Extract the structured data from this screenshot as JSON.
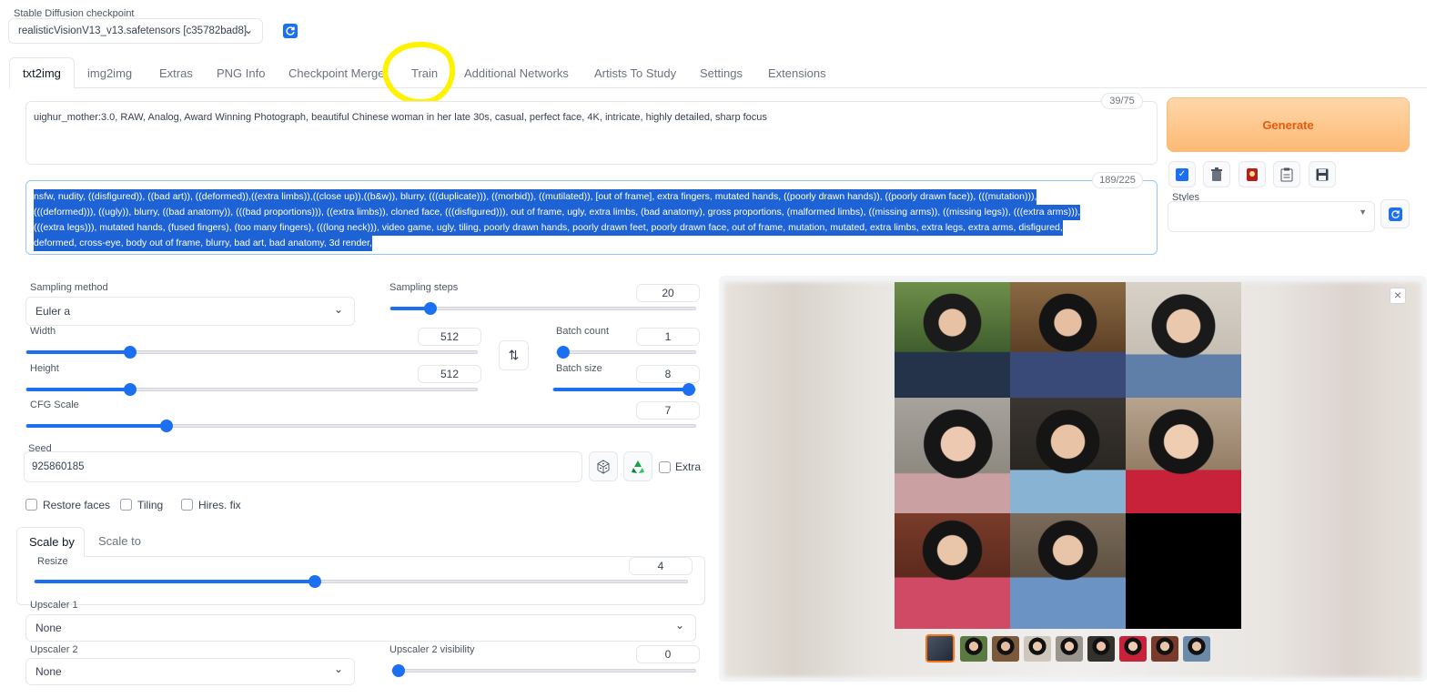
{
  "checkpoint": {
    "label": "Stable Diffusion checkpoint",
    "value": "realisticVisionV13_v13.safetensors [c35782bad8]"
  },
  "tabs": [
    {
      "label": "txt2img"
    },
    {
      "label": "img2img"
    },
    {
      "label": "Extras"
    },
    {
      "label": "PNG Info"
    },
    {
      "label": "Checkpoint Merger"
    },
    {
      "label": "Train"
    },
    {
      "label": "Additional Networks"
    },
    {
      "label": "Artists To Study"
    },
    {
      "label": "Settings"
    },
    {
      "label": "Extensions"
    }
  ],
  "prompt": {
    "text": "uighur_mother:3.0, RAW, Analog, Award Winning Photograph, beautiful Chinese woman in her late 30s, casual, perfect face, 4K, intricate, highly detailed, sharp focus",
    "counter": "39/75"
  },
  "negative_prompt": {
    "lines": [
      "nsfw, nudity, ((disfigured)), ((bad art)), ((deformed)),((extra limbs)),((close up)),((b&w)), blurry, (((duplicate))), ((morbid)), ((mutilated)), [out of frame], extra fingers, mutated hands, ((poorly drawn hands)), ((poorly drawn face)), (((mutation))),",
      "(((deformed))), ((ugly)), blurry, ((bad anatomy)), (((bad proportions))), ((extra limbs)), cloned face, (((disfigured))), out of frame, ugly, extra limbs, (bad anatomy), gross proportions, (malformed limbs), ((missing arms)), ((missing legs)), (((extra arms))),",
      "(((extra legs))), mutated hands, (fused fingers), (too many fingers), (((long neck))), video game, ugly, tiling, poorly drawn hands, poorly drawn feet, poorly drawn face, out of frame, mutation, mutated, extra limbs, extra legs, extra arms, disfigured,",
      "deformed, cross-eye, body out of frame, blurry, bad art, bad anatomy, 3d render,"
    ],
    "counter": "189/225"
  },
  "generate_label": "Generate",
  "styles_label": "Styles",
  "sampling_method": {
    "label": "Sampling method",
    "value": "Euler a"
  },
  "sampling_steps": {
    "label": "Sampling steps",
    "value": "20",
    "fraction": 0.13
  },
  "width": {
    "label": "Width",
    "value": "512",
    "fraction": 0.23
  },
  "height": {
    "label": "Height",
    "value": "512",
    "fraction": 0.23
  },
  "batch_count": {
    "label": "Batch count",
    "value": "1",
    "fraction": 0.0
  },
  "batch_size": {
    "label": "Batch size",
    "value": "8",
    "fraction": 1.0
  },
  "cfg_scale": {
    "label": "CFG Scale",
    "value": "7",
    "fraction": 0.21
  },
  "seed": {
    "label": "Seed",
    "value": "925860185",
    "extra_label": "Extra"
  },
  "options": {
    "restore_faces": "Restore faces",
    "tiling": "Tiling",
    "hires_fix": "Hires. fix"
  },
  "hires_tabs": {
    "scale_by": "Scale by",
    "scale_to": "Scale to"
  },
  "resize": {
    "label": "Resize",
    "value": "4",
    "fraction": 0.43
  },
  "upscaler1": {
    "label": "Upscaler 1",
    "value": "None"
  },
  "upscaler2": {
    "label": "Upscaler 2",
    "value": "None"
  },
  "upscaler2_visibility": {
    "label": "Upscaler 2 visibility",
    "value": "0",
    "fraction": 0.0
  },
  "close_symbol": "×",
  "colors": {
    "accent": "#1d6ff2",
    "generate_text": "#ea580c",
    "highlight": "#fff200",
    "selection": "#1e63d6"
  }
}
